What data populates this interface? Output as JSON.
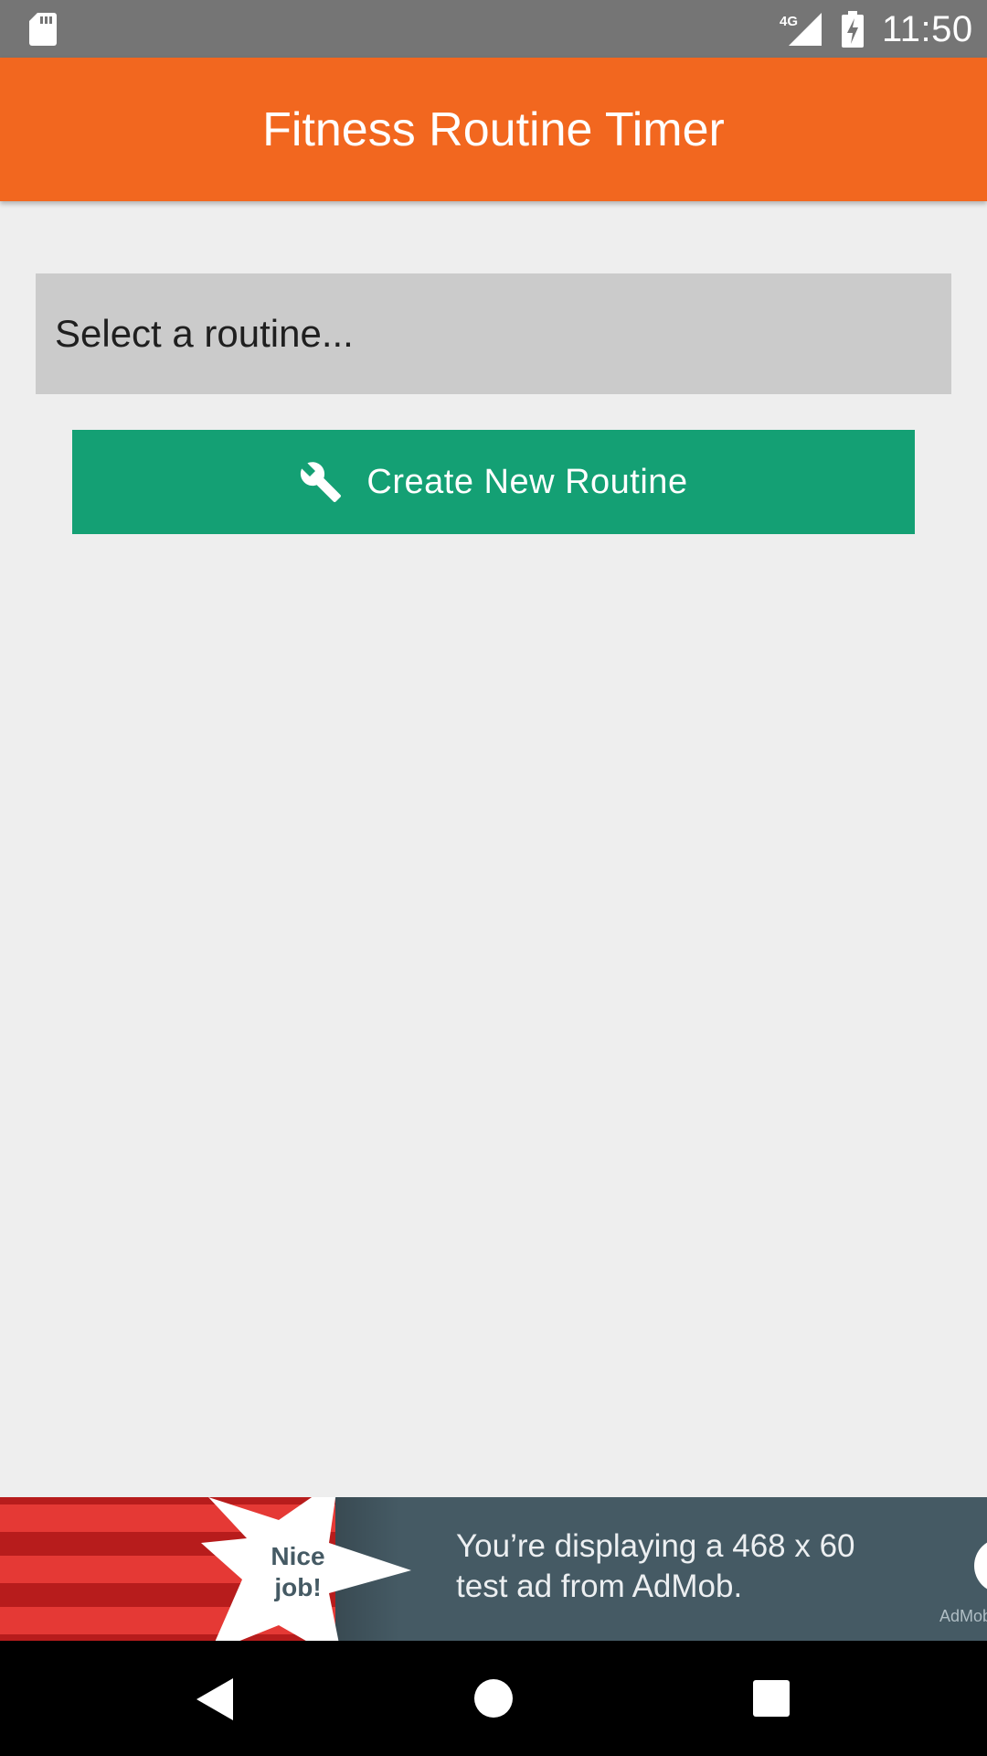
{
  "status_bar": {
    "time": "11:50",
    "network": "4G",
    "icons": [
      "sd-card-icon",
      "cellular-signal-icon",
      "battery-charging-icon"
    ]
  },
  "app_bar": {
    "title": "Fitness Routine Timer",
    "color": "#f2671f"
  },
  "routine_select": {
    "placeholder": "Select a routine..."
  },
  "create_button": {
    "label": "Create New Routine",
    "icon": "wrench-icon",
    "color": "#14a074"
  },
  "ad_banner": {
    "badge_line1": "Nice",
    "badge_line2": "job!",
    "text": "You’re displaying a 468 x 60 test ad from AdMob.",
    "logo_text": "AdMob"
  },
  "nav_bar": {
    "icons": [
      "back-icon",
      "home-icon",
      "recents-icon"
    ]
  }
}
